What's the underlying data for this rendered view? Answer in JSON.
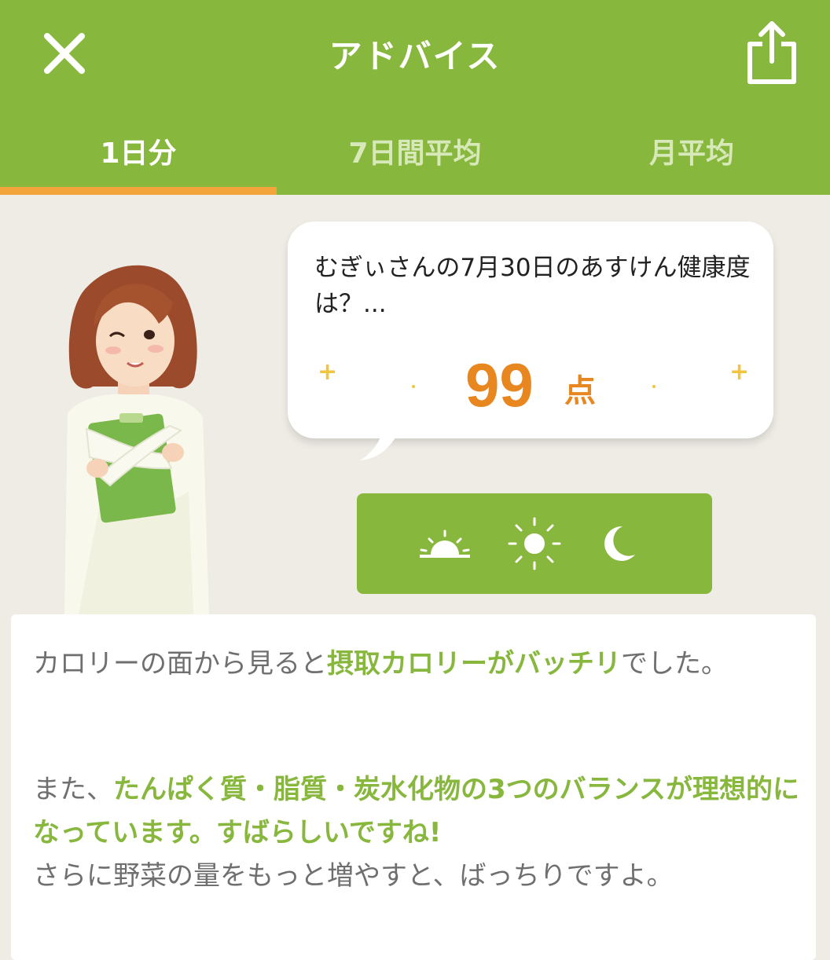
{
  "header": {
    "title": "アドバイス",
    "close_icon": "close-icon",
    "share_icon": "share-icon"
  },
  "tabs": [
    {
      "label": "1日分",
      "active": true
    },
    {
      "label": "7日間平均",
      "active": false
    },
    {
      "label": "月平均",
      "active": false
    }
  ],
  "bubble": {
    "message": "むぎぃさんの7月30日のあすけん健康度は？...",
    "score": "99",
    "score_unit": "点"
  },
  "time_buttons": [
    {
      "icon": "sunrise-icon",
      "label": "morning"
    },
    {
      "icon": "sun-icon",
      "label": "daytime"
    },
    {
      "icon": "moon-icon",
      "label": "night"
    }
  ],
  "advice": {
    "p1_a": "カロリーの面から見ると",
    "p1_hl": "摂取カロリーがバッチリ",
    "p1_b": "でした。",
    "p2_a": "また、",
    "p2_hl": "たんぱく質・脂質・炭水化物の3つのバランスが理想的になっています。すばらしいですね!",
    "p3": "さらに野菜の量をもっと増やすと、ばっちりですよ。"
  },
  "colors": {
    "header_green": "#88b73e",
    "tab_indicator": "#f3a43a",
    "score_orange": "#e8861f",
    "highlight_green": "#88b73e",
    "background": "#efece6"
  }
}
